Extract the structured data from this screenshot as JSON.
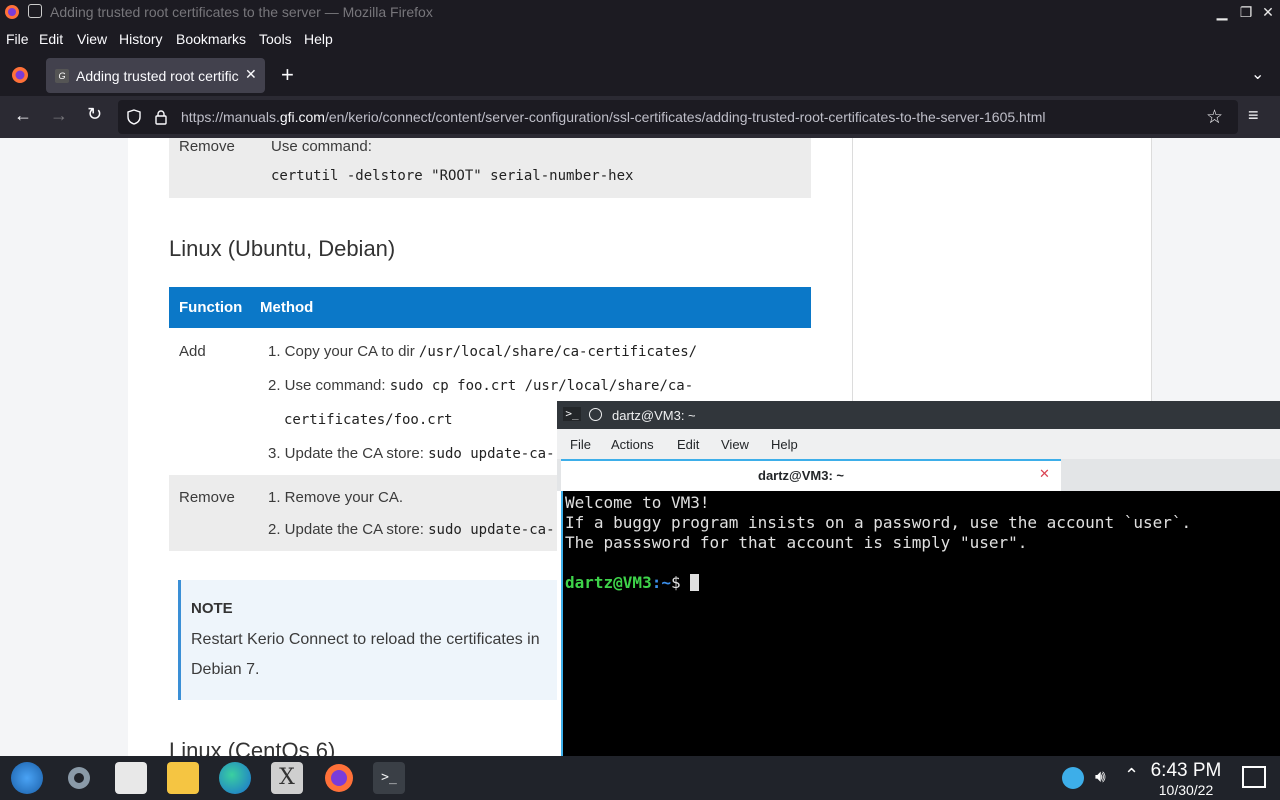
{
  "firefox": {
    "window_title": "Adding trusted root certificates to the server — Mozilla Firefox",
    "menu": [
      "File",
      "Edit",
      "View",
      "History",
      "Bookmarks",
      "Tools",
      "Help"
    ],
    "tab_title": "Adding trusted root certific",
    "url_prefix": "https://manuals.",
    "url_domain": "gfi.com",
    "url_rest": "/en/kerio/connect/content/server-configuration/ssl-certificates/adding-trusted-root-certificates-to-the-server-1605.html"
  },
  "page": {
    "top_remove_label": "Remove",
    "top_use_command": "Use command:",
    "top_command": "certutil -delstore \"ROOT\" serial-number-hex",
    "linux_heading": "Linux (Ubuntu, Debian)",
    "table_headers": [
      "Function",
      "Method"
    ],
    "add_label": "Add",
    "add_steps": [
      {
        "text": "1. Copy your CA to dir ",
        "code": "/usr/local/share/ca-certificates/"
      },
      {
        "text": "2. Use command: ",
        "code": "sudo cp foo.crt /usr/local/share/ca-"
      },
      {
        "text": "",
        "code": "certificates/foo.crt"
      },
      {
        "text": "3. Update the CA store: ",
        "code": "sudo update-ca-"
      }
    ],
    "remove_label": "Remove",
    "remove_steps": [
      {
        "text": "1. Remove your CA.",
        "code": ""
      },
      {
        "text": "2. Update the CA store: ",
        "code": "sudo update-ca-"
      }
    ],
    "note_title": "NOTE",
    "note_line1": "Restart Kerio Connect to reload the certificates in",
    "note_line2": "Debian 7.",
    "centos_heading": "Linux (CentOs 6)"
  },
  "terminal": {
    "window_title": "dartz@VM3: ~",
    "menu": [
      "File",
      "Actions",
      "Edit",
      "View",
      "Help"
    ],
    "tab_title": "dartz@VM3: ~",
    "lines": [
      "Welcome to VM3!",
      "If a buggy program insists on a password, use the account `user`.",
      "The passsword for that account is simply \"user\"."
    ],
    "prompt_user": "dartz@VM3",
    "prompt_path": ":~",
    "prompt_symbol": "$"
  },
  "taskbar": {
    "time": "6:43 PM",
    "date": "10/30/22"
  },
  "colors": {
    "accent_blue": "#0b78c8",
    "breeze_blue": "#3daee9",
    "prompt_green": "#3ed34a"
  }
}
